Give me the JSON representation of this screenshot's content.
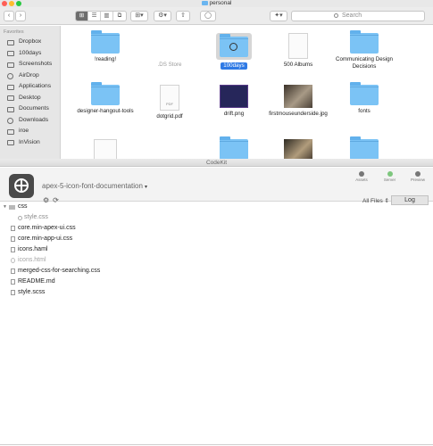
{
  "finder": {
    "window_title": "personal",
    "search_placeholder": "Search",
    "toolbar": {
      "back": "‹",
      "forward": "›",
      "view_modes": [
        "⊞",
        "☰",
        "▥",
        "⧉"
      ],
      "group_label": "⊞▾",
      "action_label": "⚙▾",
      "share_label": "⇧",
      "tag_label": "◯",
      "dropbox_label": "✦▾"
    },
    "sidebar": {
      "section": "Favorites",
      "items": [
        {
          "label": "Dropbox",
          "icon": "dropbox-icon"
        },
        {
          "label": "100days",
          "icon": "folder-icon"
        },
        {
          "label": "Screenshots",
          "icon": "folder-icon"
        },
        {
          "label": "AirDrop",
          "icon": "airdrop-icon"
        },
        {
          "label": "Applications",
          "icon": "applications-icon"
        },
        {
          "label": "Desktop",
          "icon": "desktop-icon"
        },
        {
          "label": "Documents",
          "icon": "documents-icon"
        },
        {
          "label": "Downloads",
          "icon": "downloads-icon"
        },
        {
          "label": "iroe",
          "icon": "home-icon"
        },
        {
          "label": "InVision",
          "icon": "folder-icon"
        }
      ]
    },
    "items": [
      {
        "label": "!reading!",
        "kind": "folder"
      },
      {
        "label": ".DS Store",
        "kind": "blank",
        "dim": true
      },
      {
        "label": "100days",
        "kind": "folder",
        "selected": true
      },
      {
        "label": "500 Albums",
        "kind": "doc"
      },
      {
        "label": "Communicating Design Decisions",
        "kind": "folder"
      },
      {
        "label": "designer-hangout-tools",
        "kind": "folder"
      },
      {
        "label": "dotgrid.pdf",
        "kind": "pdf",
        "pdf_tag": "PDF"
      },
      {
        "label": "drift.png",
        "kind": "image-dark"
      },
      {
        "label": "firstmouseunderside.jpg",
        "kind": "image-photo"
      },
      {
        "label": "fonts",
        "kind": "folder"
      },
      {
        "label": "",
        "kind": "doc"
      },
      {
        "label": "",
        "kind": "blank"
      },
      {
        "label": "",
        "kind": "folder"
      },
      {
        "label": "",
        "kind": "image-photo"
      },
      {
        "label": "",
        "kind": "folder"
      }
    ]
  },
  "codekit": {
    "window_title": "CodeKit",
    "project_name": "apex-5-icon-font-documentation",
    "project_caret": "▾",
    "tools": {
      "settings": "⚙",
      "refresh": "⟳"
    },
    "right_buttons": [
      {
        "label": "Assets",
        "dot": "grey"
      },
      {
        "label": "Server",
        "dot": "green"
      },
      {
        "label": "Preview",
        "dot": "grey"
      }
    ],
    "filter_label": "All Files ⇕",
    "log_button": "Log",
    "files": [
      {
        "name": "css",
        "type": "folder",
        "triangle": "▼"
      },
      {
        "name": "style.css",
        "type": "child"
      },
      {
        "name": "core.min-apex-ui.css",
        "type": "file"
      },
      {
        "name": "core.min-app-ui.css",
        "type": "file"
      },
      {
        "name": "icons.haml",
        "type": "file"
      },
      {
        "name": "icons.html",
        "type": "file",
        "dim": true
      },
      {
        "name": "merged-css-for-searching.css",
        "type": "file"
      },
      {
        "name": "README.md",
        "type": "file"
      },
      {
        "name": "style.scss",
        "type": "file"
      }
    ]
  }
}
